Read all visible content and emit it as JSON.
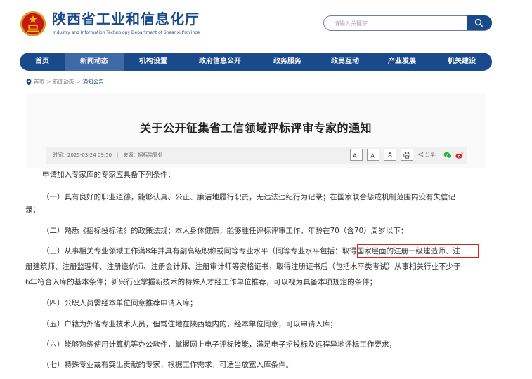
{
  "header": {
    "site_title": "陕西省工业和信息化厅",
    "site_subtitle": "Industry and Information Technology Department of Shaanxi Province"
  },
  "search": {
    "placeholder": "请输入关键字"
  },
  "nav": {
    "items": [
      {
        "label": "首页"
      },
      {
        "label": "新闻动态"
      },
      {
        "label": "机构设置"
      },
      {
        "label": "政府信息公开"
      },
      {
        "label": "政务服务"
      },
      {
        "label": "政民互动"
      },
      {
        "label": "产业发展"
      },
      {
        "label": "机关建设"
      }
    ]
  },
  "breadcrumb": {
    "home": "首页",
    "news": "新闻动态",
    "current": "通知公告",
    "separator": ">"
  },
  "article": {
    "title": "关于公开征集省工信领域评标评审专家的通知",
    "time_label": "时间：",
    "time_value": "2025-03-24 09:50",
    "divider": "|",
    "source_label": "来源：",
    "source_value": "招标监管处",
    "font_large": "A",
    "font_small": "A",
    "font_normal": "A",
    "share_label": "分享:",
    "paragraphs": [
      "申请加入专家库的专家应具备下列条件：",
      "（一）具有良好的职业道德，能够认真、公正、廉洁地履行职责，无违法违纪行为记录；在国家联合惩戒机制范围内没有失信记",
      "录；",
      "（二）熟悉《招标投标法》的政策法规；本人身体健康，能够胜任评标评审工作，年龄在70（含70）周岁以下；",
      "（三）从事相关专业领域工作满8年并具有副高级职称或同等专业水平（同等专业水平包括：取得国家层面的注册一级建造师、注",
      "册建筑师、注册监理师、注册造价师、注册会计师、注册审计师等资格证书，取得注册证书后（包括水平类考试）从事相关行业不少于",
      "6年符合入库的基本条件；新兴行业掌握新技术的特殊人才经工作单位推荐，可以视为具备本项规定的条件；",
      "（四）公职人员需经本单位同意推荐申请入库；",
      "（五）户籍为外省专业技术人员，但常住地在陕西境内的，经本单位同意，可以申请入库；",
      "（六）能够熟练使用计算机等办公软件，掌握网上电子评标技能，满足电子招投标及远程异地评标工作要求；",
      "（七）特殊专业或有突出贡献的专家，根据工作需求，可适当放宽入库条件。"
    ]
  },
  "colors": {
    "brand_blue": "#1a4a8c",
    "highlight_red": "#e02020"
  }
}
